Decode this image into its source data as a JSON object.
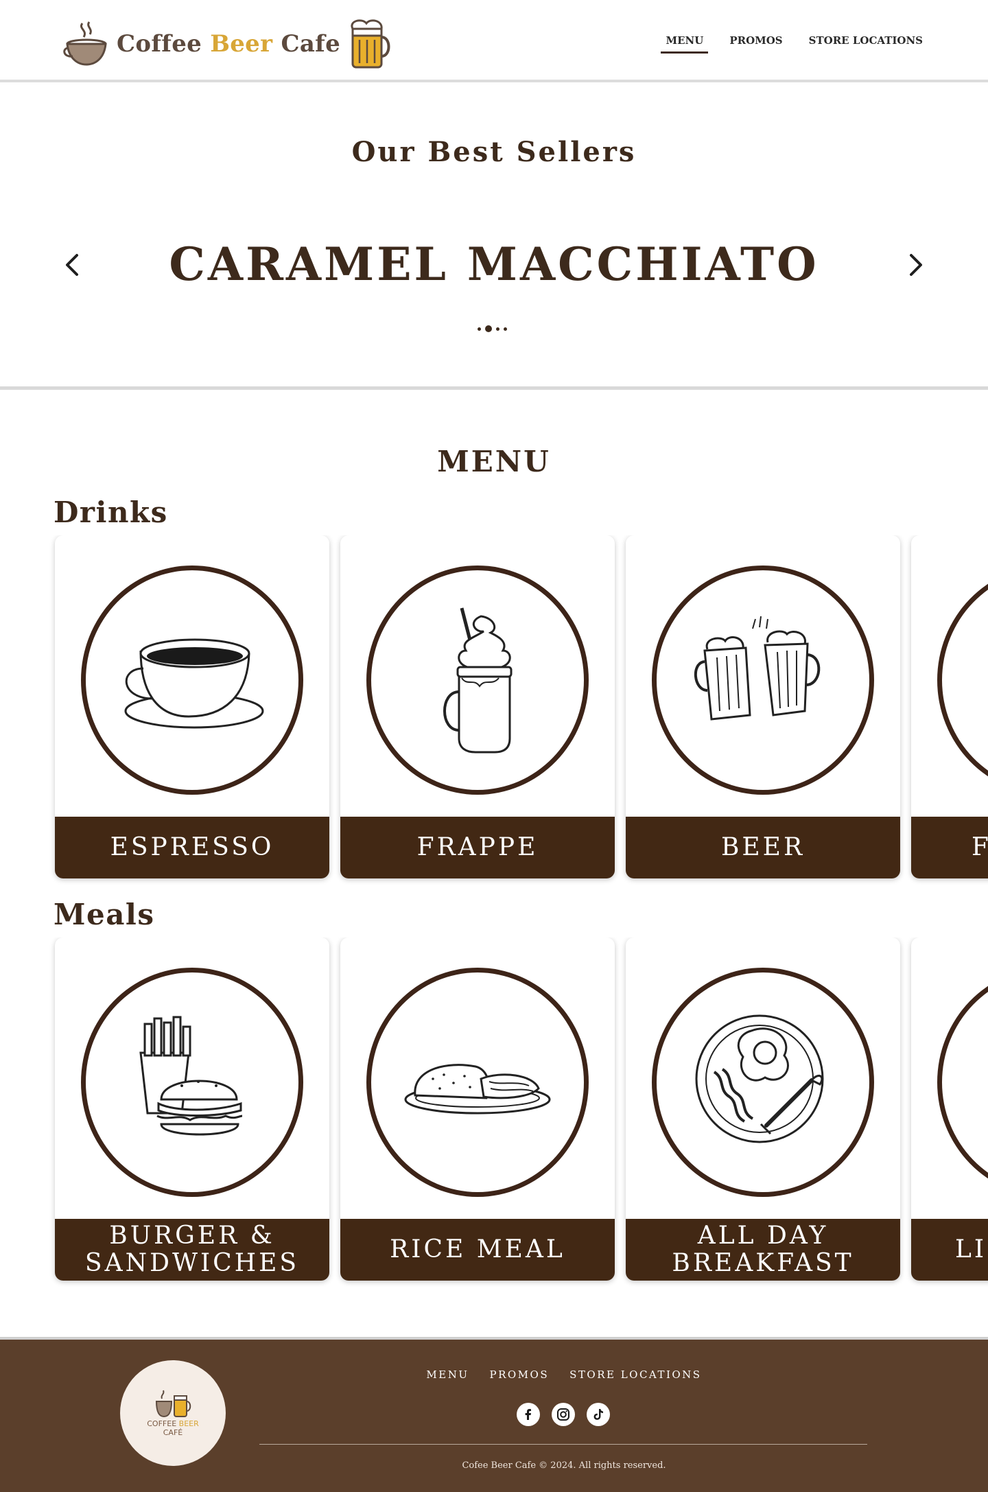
{
  "header": {
    "logo": {
      "word1": "Coffee",
      "word2": "Beer",
      "word3": "Cafe"
    },
    "nav": [
      "MENU",
      "PROMOS",
      "STORE LOCATIONS"
    ],
    "active_nav": "MENU"
  },
  "best_sellers": {
    "title": "Our Best Sellers",
    "current_item": "CARAMEL MACCHIATO",
    "slide_count": 4,
    "active_slide": 2
  },
  "menu": {
    "title": "MENU",
    "drinks": {
      "label": "Drinks",
      "items": [
        {
          "name": "ESPRESSO",
          "icon": "espresso-cup-icon"
        },
        {
          "name": "FRAPPE",
          "icon": "frappe-jar-icon"
        },
        {
          "name": "BEER",
          "icon": "beer-mugs-icon"
        },
        {
          "name": "F",
          "icon": "partial-drink-icon"
        }
      ]
    },
    "meals": {
      "label": "Meals",
      "items": [
        {
          "name": "BURGER & SANDWICHES",
          "icon": "burger-fries-icon"
        },
        {
          "name": "RICE MEAL",
          "icon": "rice-plate-icon"
        },
        {
          "name": "ALL DAY BREAKFAST",
          "icon": "breakfast-plate-icon"
        },
        {
          "name": "LI",
          "icon": "partial-meal-icon"
        }
      ]
    }
  },
  "footer": {
    "logo": {
      "word1": "COFFEE",
      "word2": "BEER",
      "word3": "CAFÉ"
    },
    "nav": [
      "MENU",
      "PROMOS",
      "STORE LOCATIONS"
    ],
    "social": [
      "facebook-icon",
      "instagram-icon",
      "tiktok-icon"
    ],
    "copyright": "Cofee Beer Cafe © 2024. All rights reserved."
  },
  "colors": {
    "brand_brown": "#3d2a1c",
    "card_label_bg": "#422814",
    "footer_bg": "#5b3f2b",
    "logo_gold": "#d8a637"
  }
}
